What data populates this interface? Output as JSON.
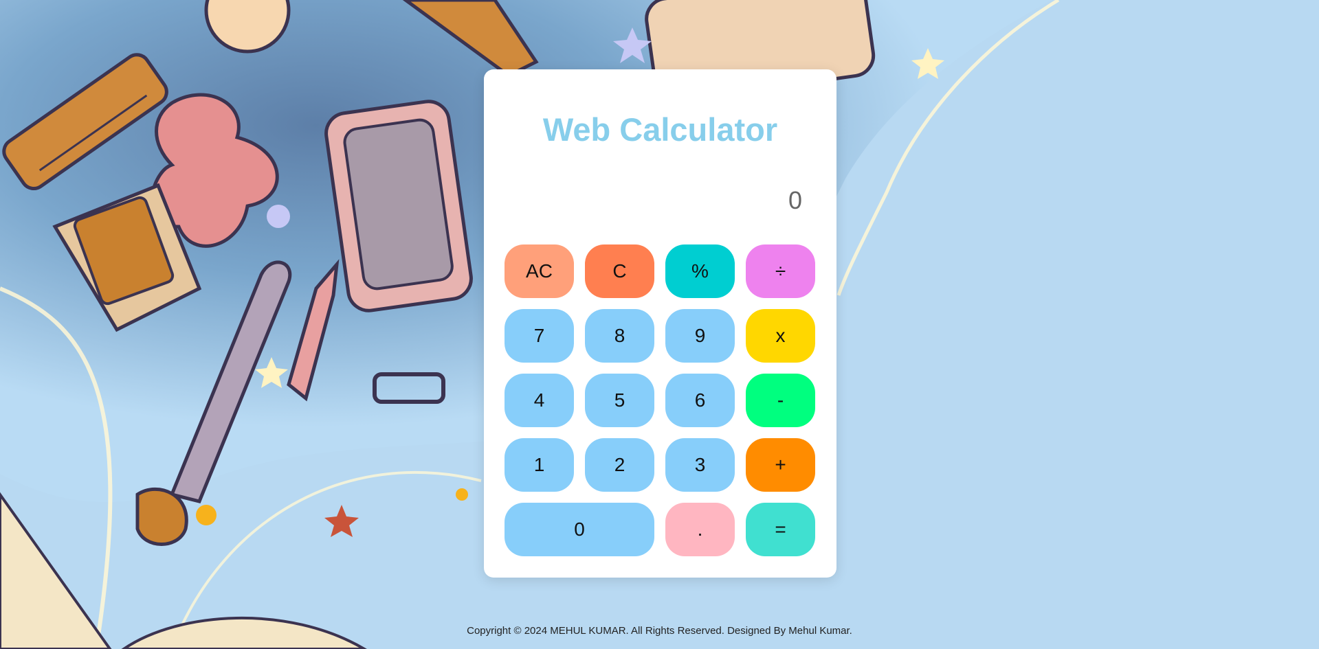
{
  "title": "Web Calculator",
  "display_value": "0",
  "keys": [
    {
      "id": "ac",
      "label": "AC",
      "color": "#ffa07a"
    },
    {
      "id": "c",
      "label": "C",
      "color": "#ff7f50"
    },
    {
      "id": "percent",
      "label": "%",
      "color": "#00ced1"
    },
    {
      "id": "divide",
      "label": "÷",
      "color": "#ee82ee"
    },
    {
      "id": "7",
      "label": "7",
      "color": "#87cefa"
    },
    {
      "id": "8",
      "label": "8",
      "color": "#87cefa"
    },
    {
      "id": "9",
      "label": "9",
      "color": "#87cefa"
    },
    {
      "id": "multiply",
      "label": "x",
      "color": "#ffd700"
    },
    {
      "id": "4",
      "label": "4",
      "color": "#87cefa"
    },
    {
      "id": "5",
      "label": "5",
      "color": "#87cefa"
    },
    {
      "id": "6",
      "label": "6",
      "color": "#87cefa"
    },
    {
      "id": "subtract",
      "label": "-",
      "color": "#00ff7f"
    },
    {
      "id": "1",
      "label": "1",
      "color": "#87cefa"
    },
    {
      "id": "2",
      "label": "2",
      "color": "#87cefa"
    },
    {
      "id": "3",
      "label": "3",
      "color": "#87cefa"
    },
    {
      "id": "add",
      "label": "+",
      "color": "#ff8c00"
    },
    {
      "id": "0",
      "label": "0",
      "color": "#87cefa",
      "wide": true
    },
    {
      "id": "decimal",
      "label": ".",
      "color": "#ffb6c1"
    },
    {
      "id": "equals",
      "label": "=",
      "color": "#40e0d0"
    }
  ],
  "footer": {
    "copyright": "Copyright © 2024 MEHUL KUMAR. All Rights Reserved. Designed By Mehul Kumar."
  },
  "colors": {
    "title": "#87ceeb",
    "card": "#ffffff",
    "display_text": "#666666"
  }
}
